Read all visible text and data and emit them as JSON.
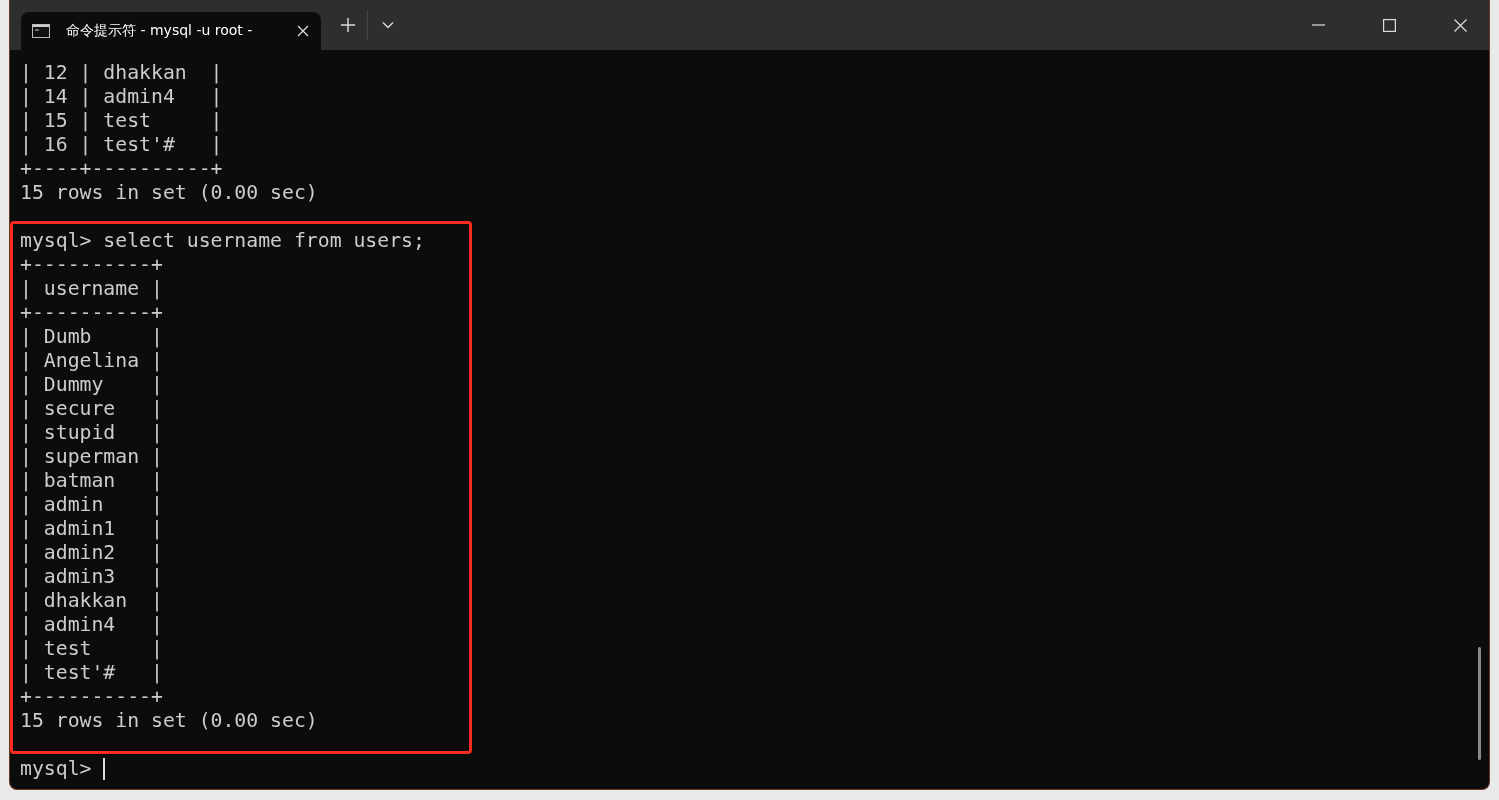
{
  "tab": {
    "title": "命令提示符 - mysql  -u root -"
  },
  "output_lines": [
    "| 12 | dhakkan  |",
    "| 14 | admin4   |",
    "| 15 | test     |",
    "| 16 | test'#   |",
    "+----+----------+",
    "15 rows in set (0.00 sec)"
  ],
  "highlighted_lines": [
    "mysql> select username from users;",
    "+----------+",
    "| username |",
    "+----------+",
    "| Dumb     |",
    "| Angelina |",
    "| Dummy    |",
    "| secure   |",
    "| stupid   |",
    "| superman |",
    "| batman   |",
    "| admin    |",
    "| admin1   |",
    "| admin2   |",
    "| admin3   |",
    "| dhakkan  |",
    "| admin4   |",
    "| test     |",
    "| test'#   |",
    "+----------+",
    "15 rows in set (0.00 sec)"
  ],
  "prompt": "mysql> "
}
